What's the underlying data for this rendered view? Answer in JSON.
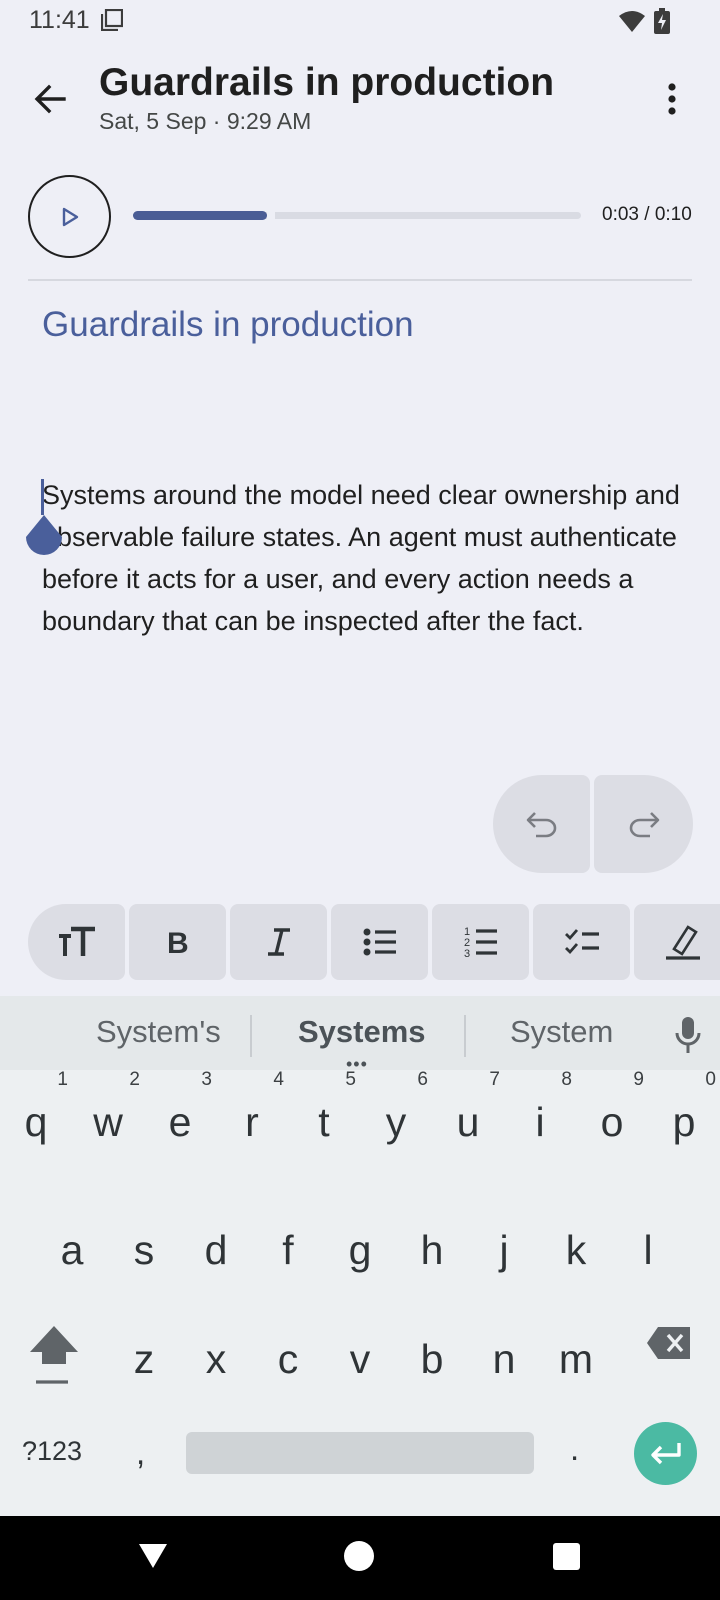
{
  "status_bar": {
    "time": "11:41"
  },
  "app_bar": {
    "title": "Guardrails in production",
    "date": "Sat, 5 Sep · 9:29 AM"
  },
  "audio": {
    "time_display": "0:03 / 0:10",
    "progress_fraction": 0.3
  },
  "note": {
    "heading": "Guardrails in production",
    "body": "Systems around the model need clear ownership and observable failure states. An agent must authenticate before it acts for a user, and every action needs a boundary that can be inspected after the fact."
  },
  "format_toolbar": {
    "items": [
      "text-size-icon",
      "bold-icon",
      "italic-icon",
      "bulleted-list-icon",
      "numbered-list-icon",
      "checklist-icon",
      "highlight-icon"
    ]
  },
  "keyboard": {
    "suggestions": [
      "System's",
      "Systems",
      "System"
    ],
    "row1": [
      {
        "key": "q",
        "hint": "1"
      },
      {
        "key": "w",
        "hint": "2"
      },
      {
        "key": "e",
        "hint": "3"
      },
      {
        "key": "r",
        "hint": "4"
      },
      {
        "key": "t",
        "hint": "5"
      },
      {
        "key": "y",
        "hint": "6"
      },
      {
        "key": "u",
        "hint": "7"
      },
      {
        "key": "i",
        "hint": "8"
      },
      {
        "key": "o",
        "hint": "9"
      },
      {
        "key": "p",
        "hint": "0"
      }
    ],
    "row2": [
      "a",
      "s",
      "d",
      "f",
      "g",
      "h",
      "j",
      "k",
      "l"
    ],
    "row3": [
      "z",
      "x",
      "c",
      "v",
      "b",
      "n",
      "m"
    ],
    "symbols_label": "?123",
    "comma": ",",
    "period": "."
  },
  "colors": {
    "accent": "#4a5f9b",
    "enter_key": "#4bbaa3"
  }
}
